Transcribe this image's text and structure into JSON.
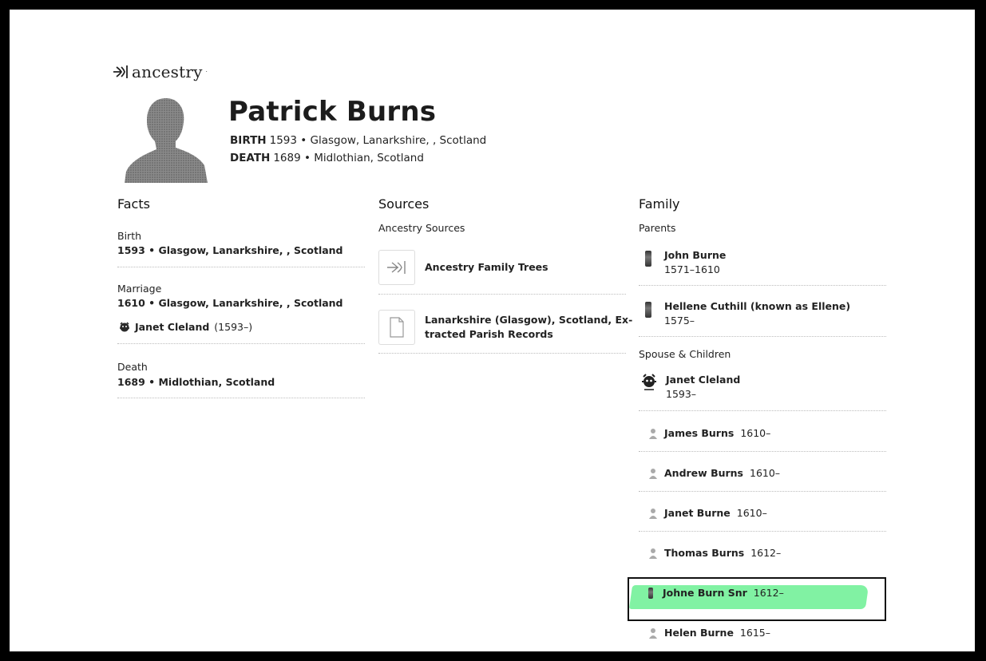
{
  "brand": {
    "logo_text": "ancestry"
  },
  "person": {
    "name": "Patrick Burns",
    "birth_label": "BIRTH",
    "birth_value": "1593 • Glasgow, Lanarkshire, , Scotland",
    "death_label": "DEATH",
    "death_value": "1689 • Midlothian, Scotland"
  },
  "facts": {
    "heading": "Facts",
    "items": [
      {
        "label": "Birth",
        "value": "1593 • Glasgow, Lanarkshire, , Scotland"
      },
      {
        "label": "Marriage",
        "value": "1610 • Glasgow, Lanarkshire, , Scotland",
        "spouse": "Janet Cleland",
        "spouse_years": "(1593–)"
      },
      {
        "label": "Death",
        "value": "1689 • Midlothian, Scotland"
      }
    ]
  },
  "sources": {
    "heading": "Sources",
    "subheading": "Ancestry Sources",
    "items": [
      {
        "line1": "Ancestry Family Trees",
        "line2": "",
        "icon": "tree-leaf-icon"
      },
      {
        "line1": "Lanarkshire (Glasgow), Scotland, Ex-",
        "line2": "tracted Parish Records",
        "icon": "document-icon"
      }
    ]
  },
  "family": {
    "heading": "Family",
    "parents_heading": "Parents",
    "parents": [
      {
        "name": "John Burne",
        "years": "1571–1610"
      },
      {
        "name": "Hellene Cuthill (known as Ellene)",
        "years": "1575–"
      }
    ],
    "spouse_heading": "Spouse & Children",
    "spouse": {
      "name": "Janet Cleland",
      "years": "1593–"
    },
    "children": [
      {
        "name": "James Burns",
        "years": "1610–"
      },
      {
        "name": "Andrew Burns",
        "years": "1610–"
      },
      {
        "name": "Janet Burne",
        "years": "1610–"
      },
      {
        "name": "Thomas Burns",
        "years": "1612–"
      },
      {
        "name": "Johne Burn Snr",
        "years": "1612–"
      },
      {
        "name": "Helen Burne",
        "years": "1615–"
      }
    ]
  }
}
